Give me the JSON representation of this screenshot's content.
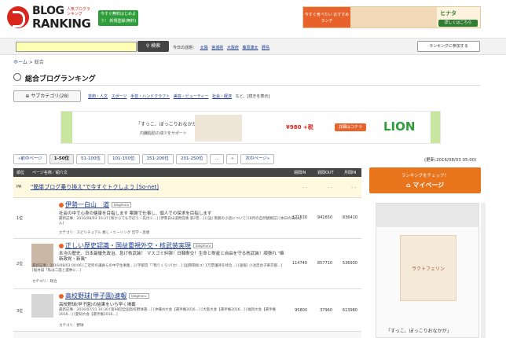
{
  "header": {
    "logo_line1": "BLOG",
    "logo_line2": "RANKING",
    "logo_tag": "人気ブログランキング",
    "register_badge": "今すぐ無料はじめよう！ 新規登録(無料)",
    "ad_top_left": "今すぐ食べたい おすすめランチ",
    "ad_top_brand": "ヒナタ",
    "ad_top_button": "詳しくはこちら"
  },
  "search": {
    "placeholder": "",
    "button": "検索",
    "today_label": "今日の話題：",
    "today_topics": [
      "太陽",
      "宮城県",
      "大阪府",
      "藤原康太",
      "野鳥"
    ],
    "join_button": "ランキングに参加する"
  },
  "breadcrumb": {
    "home": "ホーム",
    "sep": ">",
    "current": "総合"
  },
  "page_title": "総合ブログランキング",
  "subcategory_button": "サブカテゴリ(28)",
  "categories": [
    "芸術・人文",
    "スポーツ",
    "手芸・ハンドクラフト",
    "美容・ビューティー",
    "社会・経済"
  ],
  "categories_tail": "など。[続きを表示]",
  "ad_mid": {
    "catch": "「すっこ、ぼっこりおなかが」",
    "sub": "内臓脂肪の減少をサポート",
    "price": "¥980 +税",
    "button": "詳細はコチラ",
    "brand": "LION"
  },
  "pager": {
    "items": [
      "«前のページ",
      "1-50位",
      "51-100位",
      "101-150位",
      "151-200位",
      "201-250位",
      "…",
      "»",
      "次のページ»"
    ],
    "current_index": 1,
    "updated": "(更新:2016/08/03 05:00)"
  },
  "table": {
    "headers": {
      "rank": "順位",
      "name": "ページ名称／紹介文",
      "in": "週間IN",
      "out": "週間OUT",
      "month": "月間IN"
    },
    "pr": {
      "rank": "PR",
      "text": "\"簡単ブログ乗り換え\"で今すぐトクしよう [So-net]",
      "dash": "- -"
    },
    "rows": [
      {
        "rank": "1位",
        "title": "伊勢一白山　道",
        "badge": "blogmuru",
        "desc": "社会の中で心身の健康を目指します 案謝で仕事し、個人での探求を目指します",
        "meta": "最新記事：2016/08/03 10:37 [和からでも学ぼう・先付ミ…] [伊勢白山道問答集 第2巻…] [(設) 南無の小話について] [8月の自然観察記] [本日の白山さん]",
        "cat": "カテゴリ：スピリチュアル 癒し・ヒーリング 哲学・思想",
        "in": "171530",
        "out": "941650",
        "month": "836410"
      },
      {
        "rank": "2位",
        "title": "正しい歴史認識・国益重視外交・核武装実現",
        "badge": "blogmuru",
        "desc": "本当の歴史、日本最優先政治、急げ核武装！ マスゴミ糾弾！日韓断交！生命と財産と自由を守る核武装！頑張れ \"維新政党・新風\"",
        "meta": "最新記事：2016/08/03 00:06 [ご近所の議員らの中学生事集…] [宇都宮「『我りくろ!パカ!…] [国際関係ユ! 1万票護持を残念…] [速報] 小池百合子東京都…] [桜井誠「私は二度と選挙に…]",
        "cat": "カテゴリ：政治",
        "in": "114740",
        "out": "857710",
        "month": "536930"
      },
      {
        "rank": "3位",
        "title": "高校野球(甲子園)速報",
        "badge": "blogmuru",
        "desc": "高校野球(甲子園)の結果をいち早く掲載",
        "meta": "最新記事：2016/07/31 16:30 [第98回全国高校野球選…] [沖縄州大会【選手権2016…] [大阪大会【選手権2016…] [福岡大会【選手権2016…] [愛知大会【選手権2016…]",
        "cat": "カテゴリ：野球",
        "in": "95800",
        "out": "37960",
        "month": "613980"
      }
    ]
  },
  "sidebar": {
    "check_label": "ランキングをチェック！",
    "mypage": "マイページ",
    "ad_product": "ラクトフェリン",
    "ad_footer": "「すっこ、ぼっこりおなかが」"
  }
}
